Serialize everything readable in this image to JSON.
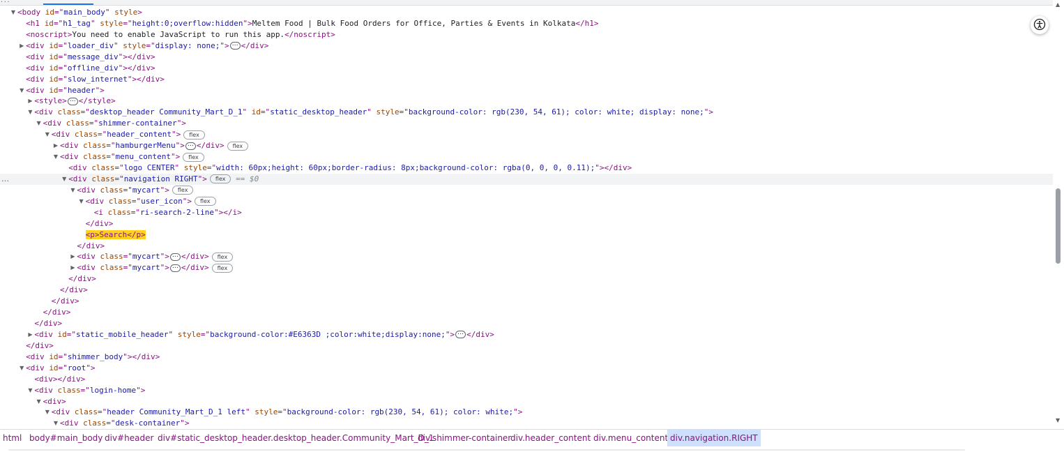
{
  "top_strip": {
    "corner_text": "···"
  },
  "lines": [
    {
      "indent": 0,
      "tw": "open",
      "parts": [
        [
          "tag",
          "<body "
        ],
        [
          "attr",
          "id"
        ],
        [
          "tag",
          "=\""
        ],
        [
          "val",
          "main_body"
        ],
        [
          "tag",
          "\" "
        ],
        [
          "attr",
          "style"
        ],
        [
          "tag",
          ">"
        ]
      ]
    },
    {
      "indent": 1,
      "tw": "",
      "parts": [
        [
          "tag",
          "<h1 "
        ],
        [
          "attr",
          "id"
        ],
        [
          "tag",
          "=\""
        ],
        [
          "val",
          "h1_tag"
        ],
        [
          "tag",
          "\" "
        ],
        [
          "attr",
          "style"
        ],
        [
          "tag",
          "=\""
        ],
        [
          "val",
          "height:0;overflow:hidden"
        ],
        [
          "tag",
          "\">"
        ],
        [
          "txt",
          "Meltem Food | Bulk Food Orders for Office, Parties & Events in Kolkata"
        ],
        [
          "tag",
          "</h1>"
        ]
      ]
    },
    {
      "indent": 1,
      "tw": "",
      "parts": [
        [
          "tag",
          "<noscript>"
        ],
        [
          "txt",
          "You need to enable JavaScript to run this app."
        ],
        [
          "tag",
          "</noscript>"
        ]
      ]
    },
    {
      "indent": 1,
      "tw": "closed",
      "parts": [
        [
          "tag",
          "<div "
        ],
        [
          "attr",
          "id"
        ],
        [
          "tag",
          "=\""
        ],
        [
          "val",
          "loader_div"
        ],
        [
          "tag",
          "\" "
        ],
        [
          "attr",
          "style"
        ],
        [
          "tag",
          "=\""
        ],
        [
          "val",
          "display: none;"
        ],
        [
          "tag",
          "\">"
        ],
        [
          "ell",
          ""
        ],
        [
          "tag",
          "</div>"
        ]
      ]
    },
    {
      "indent": 1,
      "tw": "",
      "parts": [
        [
          "tag",
          "<div "
        ],
        [
          "attr",
          "id"
        ],
        [
          "tag",
          "=\""
        ],
        [
          "val",
          "message_div"
        ],
        [
          "tag",
          "\"></div>"
        ]
      ]
    },
    {
      "indent": 1,
      "tw": "",
      "parts": [
        [
          "tag",
          "<div "
        ],
        [
          "attr",
          "id"
        ],
        [
          "tag",
          "=\""
        ],
        [
          "val",
          "offline_div"
        ],
        [
          "tag",
          "\"></div>"
        ]
      ]
    },
    {
      "indent": 1,
      "tw": "",
      "parts": [
        [
          "tag",
          "<div "
        ],
        [
          "attr",
          "id"
        ],
        [
          "tag",
          "=\""
        ],
        [
          "val",
          "slow_internet"
        ],
        [
          "tag",
          "\"></div>"
        ]
      ]
    },
    {
      "indent": 1,
      "tw": "open",
      "parts": [
        [
          "tag",
          "<div "
        ],
        [
          "attr",
          "id"
        ],
        [
          "tag",
          "=\""
        ],
        [
          "val",
          "header"
        ],
        [
          "tag",
          "\">"
        ]
      ]
    },
    {
      "indent": 2,
      "tw": "closed",
      "parts": [
        [
          "tag",
          "<style>"
        ],
        [
          "ell",
          ""
        ],
        [
          "tag",
          "</style>"
        ]
      ]
    },
    {
      "indent": 2,
      "tw": "open",
      "parts": [
        [
          "tag",
          "<div "
        ],
        [
          "attr",
          "class"
        ],
        [
          "tag",
          "=\""
        ],
        [
          "val",
          "desktop_header Community_Mart_D_1"
        ],
        [
          "tag",
          "\" "
        ],
        [
          "attr",
          "id"
        ],
        [
          "tag",
          "=\""
        ],
        [
          "val",
          "static_desktop_header"
        ],
        [
          "tag",
          "\" "
        ],
        [
          "attr",
          "style"
        ],
        [
          "tag",
          "=\""
        ],
        [
          "val",
          "background-color: rgb(230, 54, 61); color: white; display: none;"
        ],
        [
          "tag",
          "\">"
        ]
      ]
    },
    {
      "indent": 3,
      "tw": "open",
      "parts": [
        [
          "tag",
          "<div "
        ],
        [
          "attr",
          "class"
        ],
        [
          "tag",
          "=\""
        ],
        [
          "val",
          "shimmer-container"
        ],
        [
          "tag",
          "\">"
        ]
      ]
    },
    {
      "indent": 4,
      "tw": "open",
      "parts": [
        [
          "tag",
          "<div "
        ],
        [
          "attr",
          "class"
        ],
        [
          "tag",
          "=\""
        ],
        [
          "val",
          "header_content"
        ],
        [
          "tag",
          "\">"
        ],
        [
          "pill",
          "flex"
        ]
      ]
    },
    {
      "indent": 5,
      "tw": "closed",
      "parts": [
        [
          "tag",
          "<div "
        ],
        [
          "attr",
          "class"
        ],
        [
          "tag",
          "=\""
        ],
        [
          "val",
          "hamburgerMenu"
        ],
        [
          "tag",
          "\">"
        ],
        [
          "ell",
          ""
        ],
        [
          "tag",
          "</div>"
        ],
        [
          "pill",
          "flex"
        ]
      ]
    },
    {
      "indent": 5,
      "tw": "open",
      "parts": [
        [
          "tag",
          "<div "
        ],
        [
          "attr",
          "class"
        ],
        [
          "tag",
          "=\""
        ],
        [
          "val",
          "menu_content"
        ],
        [
          "tag",
          "\">"
        ],
        [
          "pill",
          "flex"
        ]
      ]
    },
    {
      "indent": 6,
      "tw": "",
      "parts": [
        [
          "tag",
          "<div "
        ],
        [
          "attr",
          "class"
        ],
        [
          "tag",
          "=\""
        ],
        [
          "val",
          "logo CENTER"
        ],
        [
          "tag",
          "\" "
        ],
        [
          "attr",
          "style"
        ],
        [
          "tag",
          "=\""
        ],
        [
          "val",
          "width: 60px;height: 60px;border-radius: 8px;background-color: rgba(0, 0, 0, 0.11);"
        ],
        [
          "tag",
          "\"></div>"
        ]
      ]
    },
    {
      "indent": 6,
      "tw": "open",
      "sel": true,
      "parts": [
        [
          "tag",
          "<div "
        ],
        [
          "attr",
          "class"
        ],
        [
          "tag",
          "=\""
        ],
        [
          "val",
          "navigation RIGHT"
        ],
        [
          "tag",
          "\">"
        ],
        [
          "pill",
          "flex"
        ],
        [
          "marker",
          " == $0"
        ]
      ]
    },
    {
      "indent": 7,
      "tw": "open",
      "parts": [
        [
          "tag",
          "<div "
        ],
        [
          "attr",
          "class"
        ],
        [
          "tag",
          "=\""
        ],
        [
          "val",
          "mycart"
        ],
        [
          "tag",
          "\">"
        ],
        [
          "pill",
          "flex"
        ]
      ]
    },
    {
      "indent": 8,
      "tw": "open",
      "parts": [
        [
          "tag",
          "<div "
        ],
        [
          "attr",
          "class"
        ],
        [
          "tag",
          "=\""
        ],
        [
          "val",
          "user_icon"
        ],
        [
          "tag",
          "\">"
        ],
        [
          "pill",
          "flex"
        ]
      ]
    },
    {
      "indent": 9,
      "tw": "",
      "parts": [
        [
          "tag",
          "<i "
        ],
        [
          "attr",
          "class"
        ],
        [
          "tag",
          "=\""
        ],
        [
          "val",
          "ri-search-2-line"
        ],
        [
          "tag",
          "\"></i>"
        ]
      ]
    },
    {
      "indent": 8,
      "tw": "",
      "parts": [
        [
          "tag",
          "</div>"
        ]
      ]
    },
    {
      "indent": 8,
      "tw": "",
      "parts": [
        [
          "hl",
          "<p>Search</p>"
        ]
      ]
    },
    {
      "indent": 7,
      "tw": "",
      "parts": [
        [
          "tag",
          "</div>"
        ]
      ]
    },
    {
      "indent": 7,
      "tw": "closed",
      "parts": [
        [
          "tag",
          "<div "
        ],
        [
          "attr",
          "class"
        ],
        [
          "tag",
          "=\""
        ],
        [
          "val",
          "mycart"
        ],
        [
          "tag",
          "\">"
        ],
        [
          "ell",
          ""
        ],
        [
          "tag",
          "</div>"
        ],
        [
          "pill",
          "flex"
        ]
      ]
    },
    {
      "indent": 7,
      "tw": "closed",
      "parts": [
        [
          "tag",
          "<div "
        ],
        [
          "attr",
          "class"
        ],
        [
          "tag",
          "=\""
        ],
        [
          "val",
          "mycart"
        ],
        [
          "tag",
          "\">"
        ],
        [
          "ell",
          ""
        ],
        [
          "tag",
          "</div>"
        ],
        [
          "pill",
          "flex"
        ]
      ]
    },
    {
      "indent": 6,
      "tw": "",
      "parts": [
        [
          "tag",
          "</div>"
        ]
      ]
    },
    {
      "indent": 5,
      "tw": "",
      "parts": [
        [
          "tag",
          "</div>"
        ]
      ]
    },
    {
      "indent": 4,
      "tw": "",
      "parts": [
        [
          "tag",
          "</div>"
        ]
      ]
    },
    {
      "indent": 3,
      "tw": "",
      "parts": [
        [
          "tag",
          "</div>"
        ]
      ]
    },
    {
      "indent": 2,
      "tw": "",
      "parts": [
        [
          "tag",
          "</div>"
        ]
      ]
    },
    {
      "indent": 2,
      "tw": "closed",
      "parts": [
        [
          "tag",
          "<div "
        ],
        [
          "attr",
          "id"
        ],
        [
          "tag",
          "=\""
        ],
        [
          "val",
          "static_mobile_header"
        ],
        [
          "tag",
          "\" "
        ],
        [
          "attr",
          "style"
        ],
        [
          "tag",
          "=\""
        ],
        [
          "val",
          "background-color:#E6363D ;color:white;display:none;"
        ],
        [
          "tag",
          "\">"
        ],
        [
          "ell",
          ""
        ],
        [
          "tag",
          "</div>"
        ]
      ]
    },
    {
      "indent": 1,
      "tw": "",
      "parts": [
        [
          "tag",
          "</div>"
        ]
      ]
    },
    {
      "indent": 1,
      "tw": "",
      "parts": [
        [
          "tag",
          "<div "
        ],
        [
          "attr",
          "id"
        ],
        [
          "tag",
          "=\""
        ],
        [
          "val",
          "shimmer_body"
        ],
        [
          "tag",
          "\"></div>"
        ]
      ]
    },
    {
      "indent": 1,
      "tw": "open",
      "parts": [
        [
          "tag",
          "<div "
        ],
        [
          "attr",
          "id"
        ],
        [
          "tag",
          "=\""
        ],
        [
          "val",
          "root"
        ],
        [
          "tag",
          "\">"
        ]
      ]
    },
    {
      "indent": 2,
      "tw": "",
      "parts": [
        [
          "tag",
          "<div></div>"
        ]
      ]
    },
    {
      "indent": 2,
      "tw": "open",
      "parts": [
        [
          "tag",
          "<div "
        ],
        [
          "attr",
          "class"
        ],
        [
          "tag",
          "=\""
        ],
        [
          "val",
          "login-home"
        ],
        [
          "tag",
          "\">"
        ]
      ]
    },
    {
      "indent": 3,
      "tw": "open",
      "parts": [
        [
          "tag",
          "<div>"
        ]
      ]
    },
    {
      "indent": 4,
      "tw": "open",
      "parts": [
        [
          "tag",
          "<div "
        ],
        [
          "attr",
          "class"
        ],
        [
          "tag",
          "=\""
        ],
        [
          "val",
          "header Community_Mart_D_1 left"
        ],
        [
          "tag",
          "\" "
        ],
        [
          "attr",
          "style"
        ],
        [
          "tag",
          "=\""
        ],
        [
          "val",
          "background-color: rgb(230, 54, 61); color: white;"
        ],
        [
          "tag",
          "\">"
        ]
      ]
    },
    {
      "indent": 5,
      "tw": "open",
      "parts": [
        [
          "tag",
          "<div "
        ],
        [
          "attr",
          "class"
        ],
        [
          "tag",
          "=\""
        ],
        [
          "val",
          "desk-container"
        ],
        [
          "tag",
          "\">"
        ]
      ]
    }
  ],
  "breadcrumbs": [
    {
      "label": "html",
      "active": false
    },
    {
      "label": "body#main_body",
      "active": false
    },
    {
      "label": "div#header",
      "active": false
    },
    {
      "label": "div#static_desktop_header.desktop_header.Community_Mart_D_1",
      "active": false
    },
    {
      "label": "div.shimmer-container",
      "active": false
    },
    {
      "label": "div.header_content",
      "active": false
    },
    {
      "label": "div.menu_content",
      "active": false
    },
    {
      "label": "div.navigation.RIGHT",
      "active": true
    }
  ],
  "icons": {
    "accessibility": "accessibility-icon",
    "expanded": "▼",
    "collapsed": "▶",
    "scroll_up": "▲",
    "scroll_down": "▼"
  }
}
